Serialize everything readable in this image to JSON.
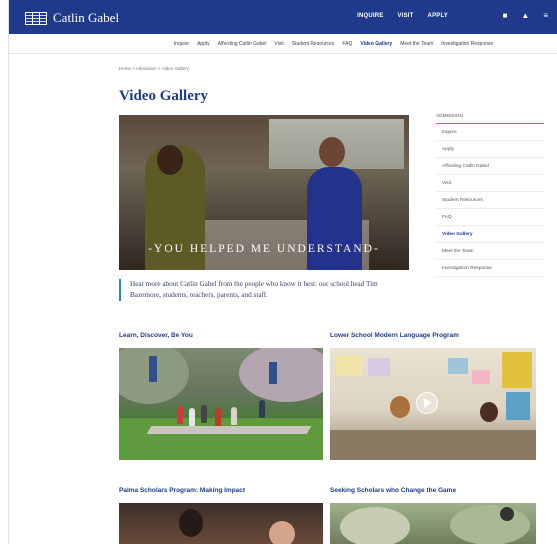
{
  "header": {
    "logo_text": "Catlin Gabel",
    "nav": [
      "INQUIRE",
      "VISIT",
      "APPLY"
    ],
    "icons": [
      "lock-icon",
      "user-icon",
      "menu-icon"
    ]
  },
  "subnav": {
    "items": [
      "Inquire",
      "Apply",
      "Affording Catlin Gabel",
      "Visit",
      "Student Resources",
      "FAQ",
      "Video Gallery",
      "Meet the Team",
      "Investigation Response"
    ],
    "active": "Video Gallery"
  },
  "breadcrumb": "Home > Admission > Video Gallery",
  "page_title": "Video Gallery",
  "hero": {
    "caption": "-YOU HELPED ME UNDERSTAND-"
  },
  "intro": "Hear more about Catlin Gabel from the people who know it best: our school head Tim Bazemore, students, teachers, parents, and staff.",
  "sidebar": {
    "heading": "ADMISSION",
    "items": [
      "Inquire",
      "Apply",
      "Affording Catlin Gabel",
      "Visit",
      "Student Resources",
      "FAQ",
      "Video Gallery",
      "Meet the Team",
      "Investigation Response"
    ],
    "active": "Video Gallery"
  },
  "videos": [
    {
      "title": "Learn, Discover, Be You"
    },
    {
      "title": "Lower School Modern Language Program"
    },
    {
      "title": "Palma Scholars Program: Making Impact"
    },
    {
      "title": "Seeking Scholars who Change the Game"
    }
  ],
  "colors": {
    "brand": "#1f3a8a",
    "accent": "#2a9abf"
  }
}
